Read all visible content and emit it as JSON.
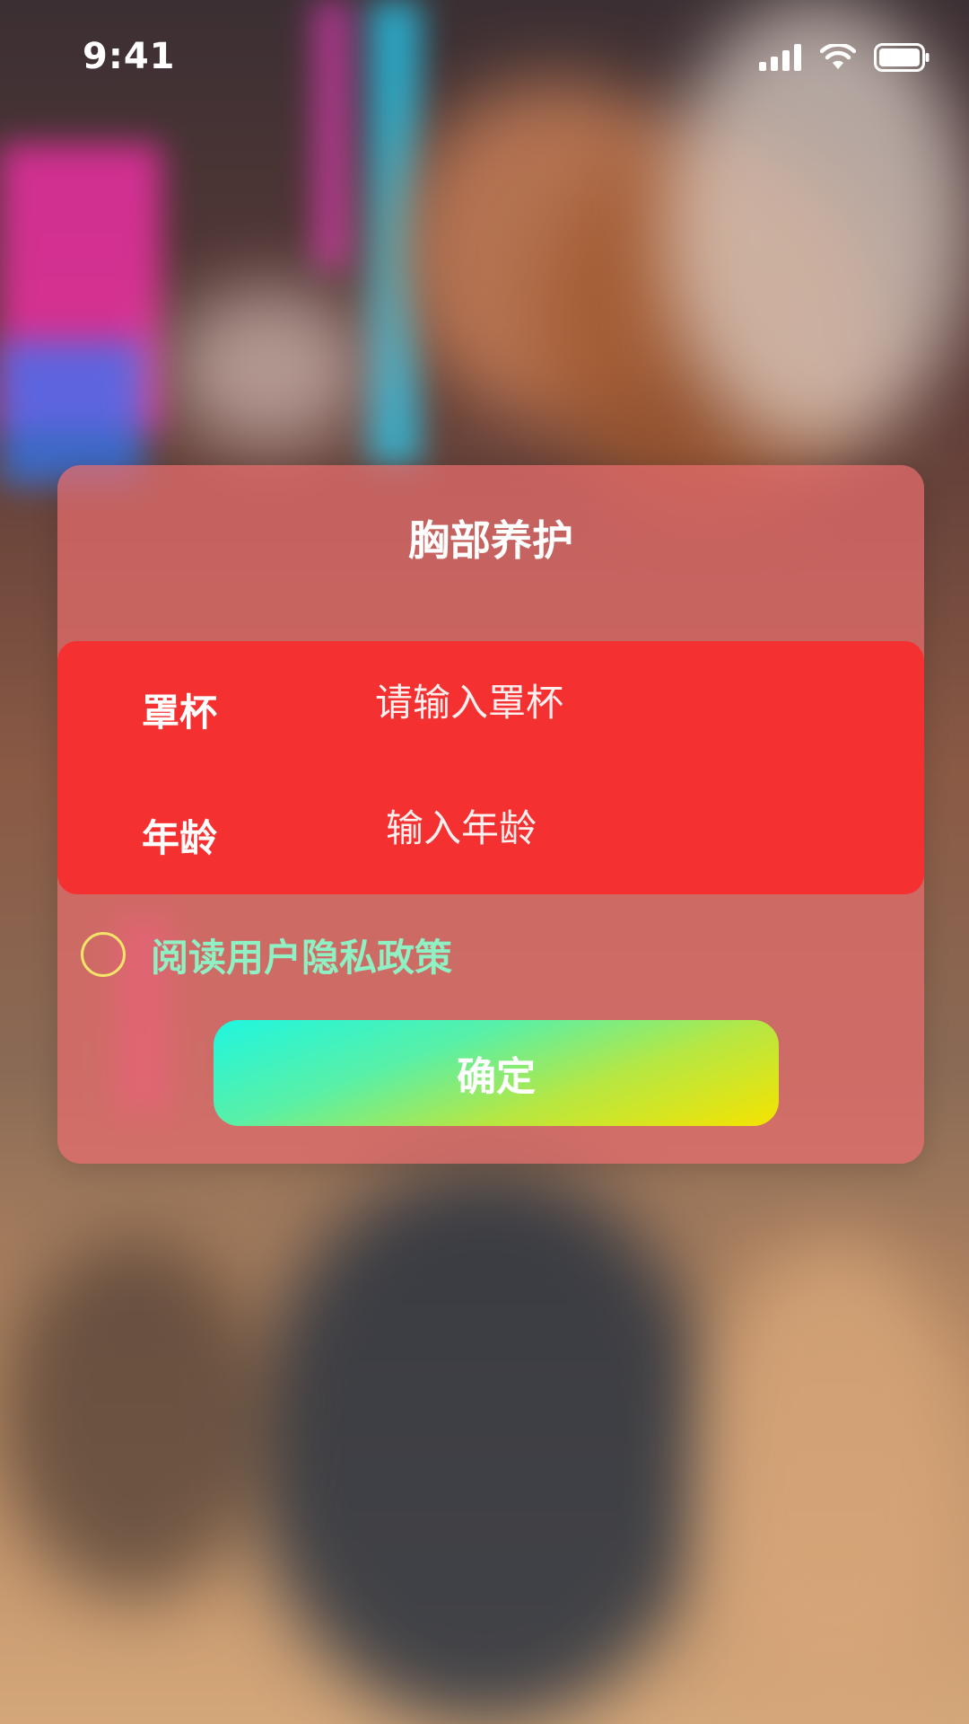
{
  "status_bar": {
    "time": "9:41",
    "icons": [
      "cellular-signal-icon",
      "wifi-icon",
      "battery-icon"
    ]
  },
  "card": {
    "title": "胸部养护",
    "fields": [
      {
        "label": "罩杯",
        "placeholder": "请输入罩杯",
        "value": ""
      },
      {
        "label": "年龄",
        "placeholder": "输入年龄",
        "value": ""
      }
    ],
    "privacy": {
      "text": "阅读用户隐私政策",
      "checked": false
    },
    "confirm_label": "确定"
  },
  "colors": {
    "card_background": "#E86E6E",
    "form_panel": "#F72C2C",
    "privacy_text": "#8FF0C4",
    "checkbox_border": "#F4E56A",
    "button_gradient_start": "#1FF6DF",
    "button_gradient_end": "#F5E300",
    "text_primary": "#FFFFFF"
  }
}
